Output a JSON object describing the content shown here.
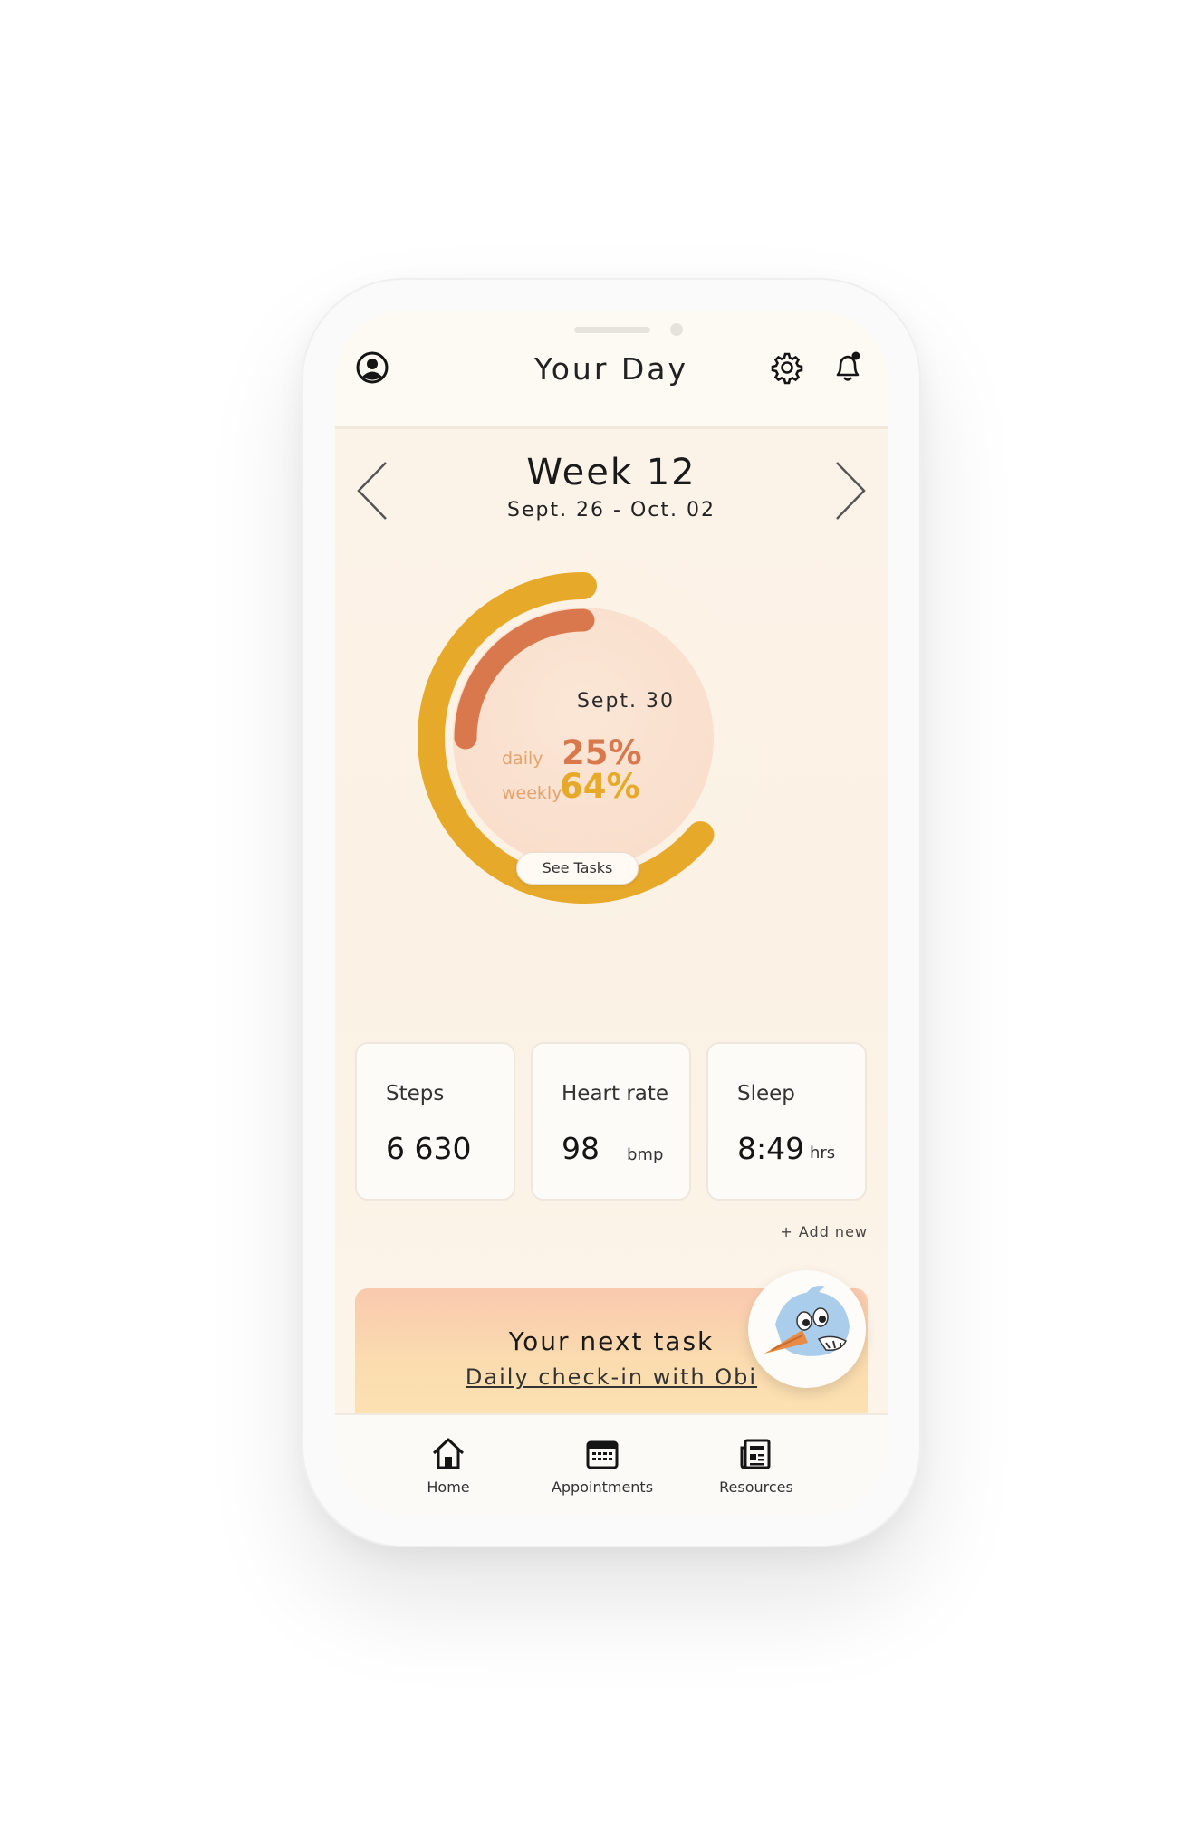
{
  "header": {
    "title": "Your Day",
    "profile_icon": "user-circle-icon",
    "settings_icon": "gear-icon",
    "notifications_icon": "bell-icon"
  },
  "week": {
    "title": "Week 12",
    "dates": "Sept. 26 - Oct. 02",
    "prev_icon": "chevron-left-icon",
    "next_icon": "chevron-right-icon"
  },
  "progress": {
    "date": "Sept. 30",
    "daily_label": "daily",
    "daily_value": "25%",
    "daily_fraction": 0.25,
    "weekly_label": "weekly",
    "weekly_value": "64%",
    "weekly_fraction": 0.64,
    "see_tasks_label": "See Tasks",
    "colors": {
      "daily": "#d9784d",
      "weekly": "#e7a92a"
    }
  },
  "stats": [
    {
      "label": "Steps",
      "value": "6 630",
      "unit": ""
    },
    {
      "label": "Heart rate",
      "value": "98",
      "unit": "bmp"
    },
    {
      "label": "Sleep",
      "value": "8:49",
      "unit": "hrs"
    }
  ],
  "add_new_label": "+ Add new",
  "next_task": {
    "title": "Your next task",
    "link": "Daily check-in with Obi",
    "mascot_icon": "bird-mascot-icon"
  },
  "tabs": [
    {
      "label": "Home",
      "icon": "home-icon"
    },
    {
      "label": "Appointments",
      "icon": "calendar-icon"
    },
    {
      "label": "Resources",
      "icon": "newspaper-icon"
    }
  ]
}
